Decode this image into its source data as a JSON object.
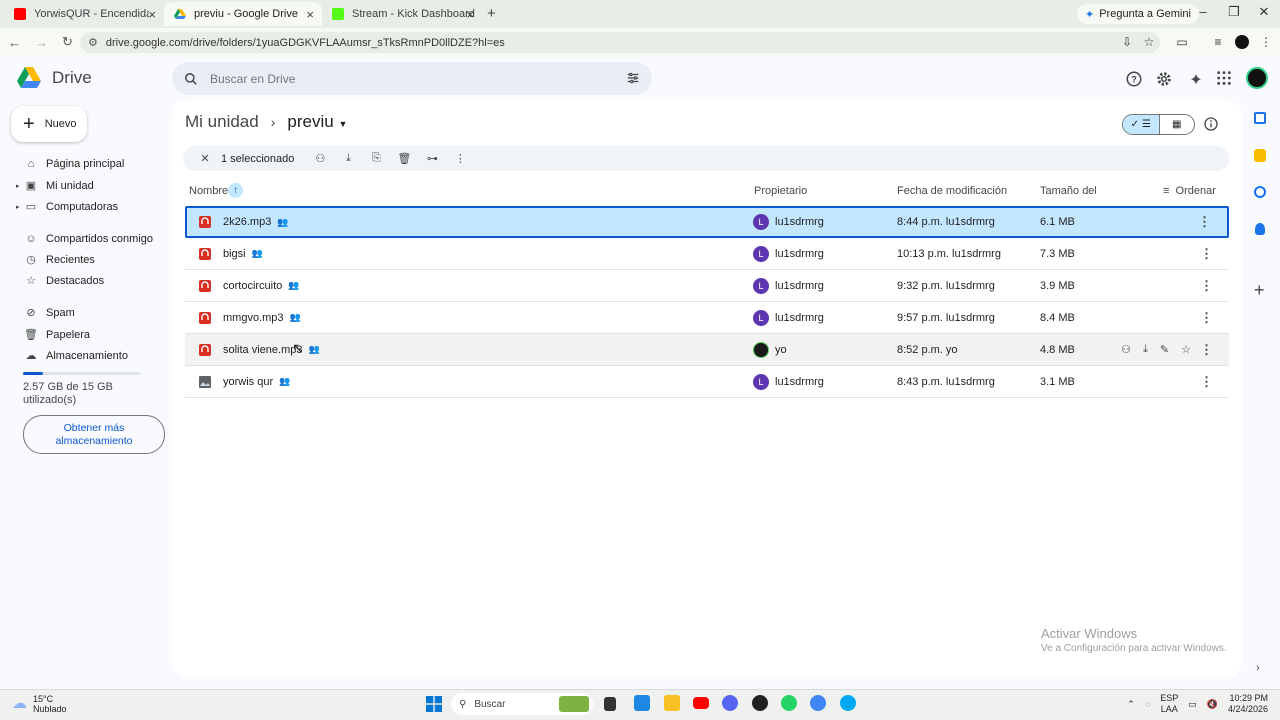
{
  "browser": {
    "tabs": [
      {
        "title": "YorwisQUR - Encendida | (Prod",
        "favicon_color": "#ff0000"
      },
      {
        "title": "previu - Google Drive",
        "favicon_color": "#1a73e8"
      },
      {
        "title": "Stream - Kick Dashboard",
        "favicon_color": "#53fc18"
      }
    ],
    "gemini_label": "Pregunta a Gemini",
    "url": "drive.google.com/drive/folders/1yuaGDGKVFLAAumsr_sTksRmnPD0llDZE?hl=es"
  },
  "drive": {
    "logo_text": "Drive",
    "search_placeholder": "Buscar en Drive",
    "new_label": "Nuevo",
    "nav": [
      {
        "label": "Página principal",
        "icon": "home-icon"
      },
      {
        "label": "Mi unidad",
        "icon": "drive-icon"
      },
      {
        "label": "Computadoras",
        "icon": "computer-icon"
      },
      {
        "label": "Compartidos conmigo",
        "icon": "people-icon"
      },
      {
        "label": "Recientes",
        "icon": "clock-icon"
      },
      {
        "label": "Destacados",
        "icon": "star-icon"
      },
      {
        "label": "Spam",
        "icon": "spam-icon"
      },
      {
        "label": "Papelera",
        "icon": "trash-icon"
      },
      {
        "label": "Almacenamiento",
        "icon": "cloud-icon"
      }
    ],
    "storage": {
      "used_fraction": 0.17,
      "text_line1": "2.57 GB de 15 GB",
      "text_line2": "utilizado(s)",
      "button_line1": "Obtener más",
      "button_line2": "almacenamiento"
    },
    "breadcrumb": {
      "parent": "Mi unidad",
      "current": "previu"
    },
    "selection_text": "1 seleccionado",
    "columns": {
      "name": "Nombre",
      "owner": "Propietario",
      "modified": "Fecha de modificación",
      "size": "Tamaño del a",
      "sort": "Ordenar"
    },
    "files": [
      {
        "name": "2k26.mp3",
        "owner": "lu1sdrmrg",
        "owner_initial": "L",
        "modified": "8:44 p.m. lu1sdrmrg",
        "size": "6.1 MB",
        "type": "audio"
      },
      {
        "name": "bigsi",
        "owner": "lu1sdrmrg",
        "owner_initial": "L",
        "modified": "10:13 p.m. lu1sdrmrg",
        "size": "7.3 MB",
        "type": "audio"
      },
      {
        "name": "cortocircuito",
        "owner": "lu1sdrmrg",
        "owner_initial": "L",
        "modified": "9:32 p.m. lu1sdrmrg",
        "size": "3.9 MB",
        "type": "audio"
      },
      {
        "name": "mmgvo.mp3",
        "owner": "lu1sdrmrg",
        "owner_initial": "L",
        "modified": "9:57 p.m. lu1sdrmrg",
        "size": "8.4 MB",
        "type": "audio"
      },
      {
        "name": "solita viene.mp3",
        "owner": "yo",
        "owner_initial": "",
        "modified": "8:52 p.m. yo",
        "size": "4.8 MB",
        "type": "audio"
      },
      {
        "name": "yorwis qur",
        "owner": "lu1sdrmrg",
        "owner_initial": "L",
        "modified": "8:43 p.m. lu1sdrmrg",
        "size": "3.1 MB",
        "type": "image"
      }
    ],
    "watermark": {
      "title": "Activar Windows",
      "sub": "Ve a Configuración para activar Windows."
    }
  },
  "taskbar": {
    "temp": "15°C",
    "weather": "Nublado",
    "search_label": "Buscar",
    "lang_line1": "ESP",
    "lang_line2": "LAA",
    "time": "10:29 PM",
    "date": "4/24/2026"
  }
}
